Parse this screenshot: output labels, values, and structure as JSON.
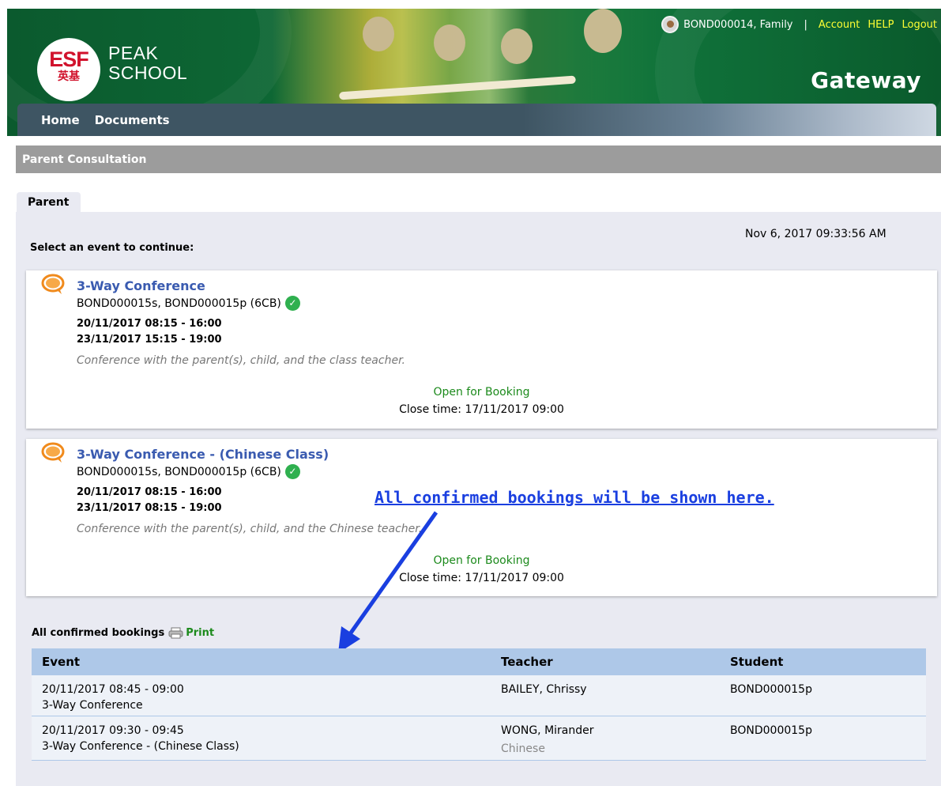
{
  "header": {
    "logo_text": "ESF",
    "logo_chinese": "英基",
    "school_line1": "PEAK",
    "school_line2": "SCHOOL",
    "portal_name": "Gateway",
    "user_label": "BOND000014, Family",
    "separator": "|",
    "links": {
      "account": "Account",
      "help": "HELP",
      "logout": "Logout"
    }
  },
  "nav": {
    "items": [
      {
        "label": "Home"
      },
      {
        "label": "Documents"
      }
    ]
  },
  "section_title": "Parent Consultation",
  "tab_label": "Parent",
  "timestamp": "Nov 6, 2017 09:33:56 AM",
  "select_prompt": "Select an event to continue:",
  "events": [
    {
      "title": "3-Way Conference",
      "students": "BOND000015s, BOND000015p (6CB)",
      "dates": [
        "20/11/2017 08:15 - 16:00",
        "23/11/2017 15:15 - 19:00"
      ],
      "description": "Conference with the parent(s), child, and the class teacher.",
      "status": "Open for Booking",
      "close_time": "Close time: 17/11/2017 09:00"
    },
    {
      "title": "3-Way Conference - (Chinese Class)",
      "students": "BOND000015s, BOND000015p (6CB)",
      "dates": [
        "20/11/2017 08:15 - 16:00",
        "23/11/2017 08:15 - 19:00"
      ],
      "description": "Conference with the parent(s), child, and the Chinese teacher.",
      "status": "Open for Booking",
      "close_time": "Close time: 17/11/2017 09:00"
    }
  ],
  "annotation": "All confirmed bookings will be shown here.",
  "bookings": {
    "heading": "All confirmed bookings",
    "print_label": "Print",
    "columns": [
      "Event",
      "Teacher",
      "Student"
    ],
    "rows": [
      {
        "time": "20/11/2017 08:45 - 09:00",
        "event": "3-Way Conference",
        "teacher": "BAILEY, Chrissy",
        "subject": "",
        "student": "BOND000015p"
      },
      {
        "time": "20/11/2017 09:30 - 09:45",
        "event": "3-Way Conference - (Chinese Class)",
        "teacher": "WONG, Mirander",
        "subject": "Chinese",
        "student": "BOND000015p"
      }
    ]
  },
  "colors": {
    "banner_green": "#0e6a36",
    "link_yellow": "#ffff33",
    "event_title_blue": "#3a5bb0",
    "status_green": "#1c8a1c",
    "annotation_blue": "#1a3fe0",
    "table_header": "#aec8e8"
  }
}
